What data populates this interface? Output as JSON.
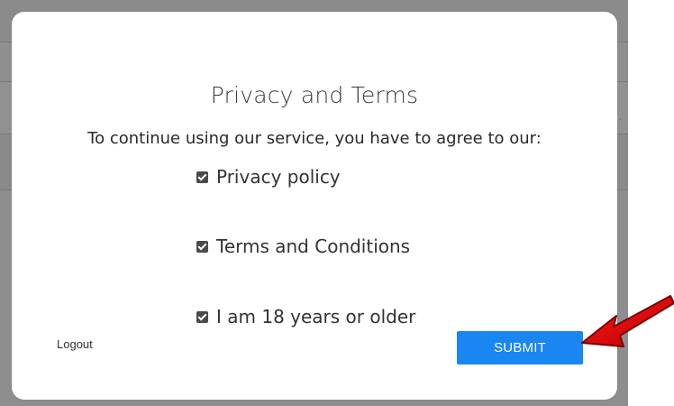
{
  "modal": {
    "title": "Privacy and Terms",
    "intro": "To continue using our service, you have to agree to our:",
    "agreements": [
      {
        "label": "Privacy policy",
        "checked": true
      },
      {
        "label": "Terms and Conditions",
        "checked": true
      },
      {
        "label": "I am 18 years or older",
        "checked": true
      }
    ],
    "logout_label": "Logout",
    "submit_label": "SUBMIT"
  },
  "colors": {
    "accent": "#1a86f2",
    "annotation_arrow": "#d40000",
    "backdrop": "#8d8d8d"
  },
  "icons": {
    "checkbox": "checkbox-checked-icon",
    "annotation": "arrow-pointer-icon"
  }
}
